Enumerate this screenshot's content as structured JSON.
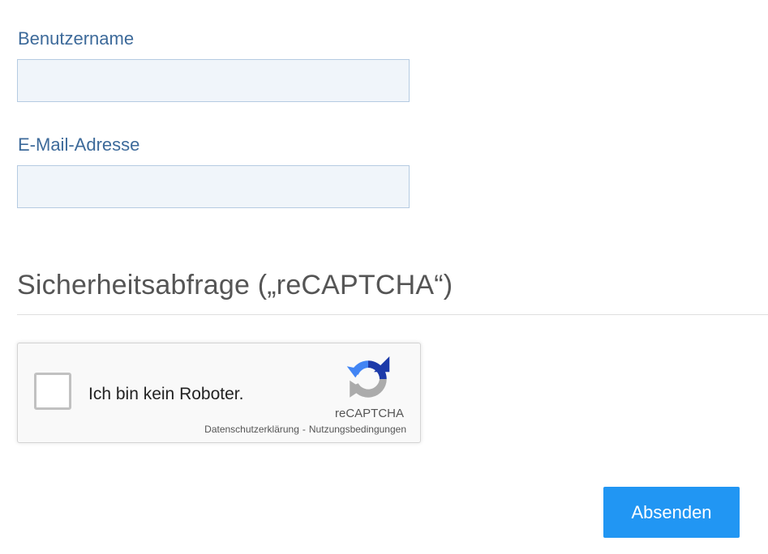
{
  "form": {
    "username": {
      "label": "Benutzername",
      "value": ""
    },
    "email": {
      "label": "E-Mail-Adresse",
      "value": ""
    }
  },
  "security": {
    "title": "Sicherheitsabfrage („reCAPTCHA“)"
  },
  "recaptcha": {
    "checkbox_label": "Ich bin kein Roboter.",
    "brand": "reCAPTCHA",
    "privacy_link": "Datenschutzerklärung",
    "separator": "-",
    "terms_link": "Nutzungsbedingungen",
    "logo_icon": "recaptcha-logo-icon",
    "colors": {
      "blue_dark": "#1c3aa9",
      "blue_light": "#4285f4",
      "gray": "#ababab"
    }
  },
  "actions": {
    "submit_label": "Absenden",
    "submit_color": "#2196f3"
  }
}
